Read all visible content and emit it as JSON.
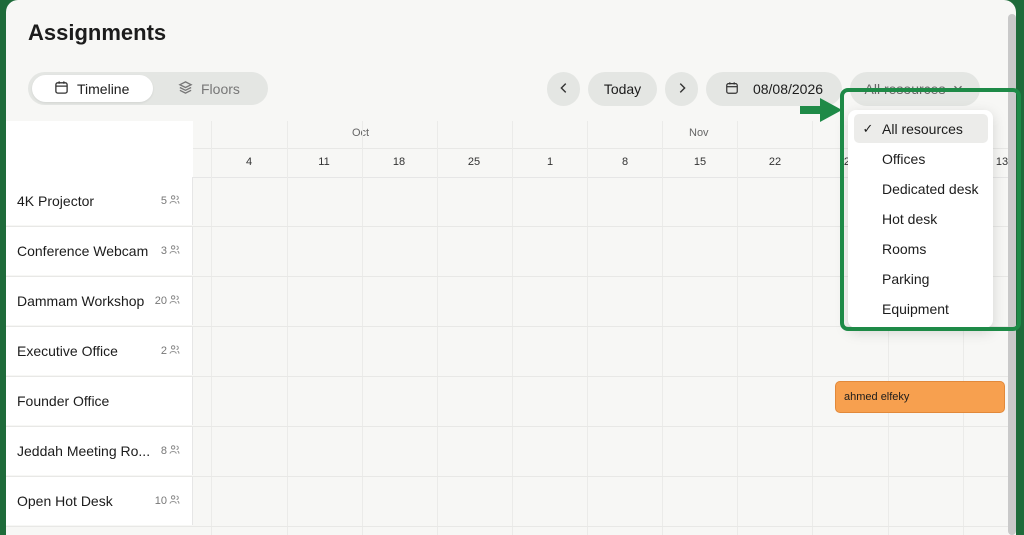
{
  "page": {
    "title": "Assignments"
  },
  "view_toggle": {
    "timeline": "Timeline",
    "floors": "Floors"
  },
  "nav": {
    "today": "Today",
    "date": "08/08/2026",
    "resource_filter": "All resources"
  },
  "months": [
    "Oct",
    "Nov"
  ],
  "days": [
    "4",
    "11",
    "18",
    "25",
    "1",
    "8",
    "15",
    "22",
    "29",
    "13"
  ],
  "resources": [
    {
      "name": "4K Projector",
      "capacity": "5"
    },
    {
      "name": "Conference Webcam",
      "capacity": "3"
    },
    {
      "name": "Dammam Workshop",
      "capacity": "20"
    },
    {
      "name": "Executive Office",
      "capacity": "2"
    },
    {
      "name": "Founder Office",
      "capacity": ""
    },
    {
      "name": "Jeddah Meeting Ro...",
      "capacity": "8"
    },
    {
      "name": "Open Hot Desk",
      "capacity": "10"
    }
  ],
  "booking": {
    "label": "ahmed elfeky"
  },
  "dropdown": {
    "items": [
      "All resources",
      "Offices",
      "Dedicated desk",
      "Hot desk",
      "Rooms",
      "Parking",
      "Equipment"
    ],
    "selected": "All resources"
  },
  "colors": {
    "accent": "#1e8a47",
    "booking": "#f7a04f",
    "background": "#f7f7f5"
  }
}
